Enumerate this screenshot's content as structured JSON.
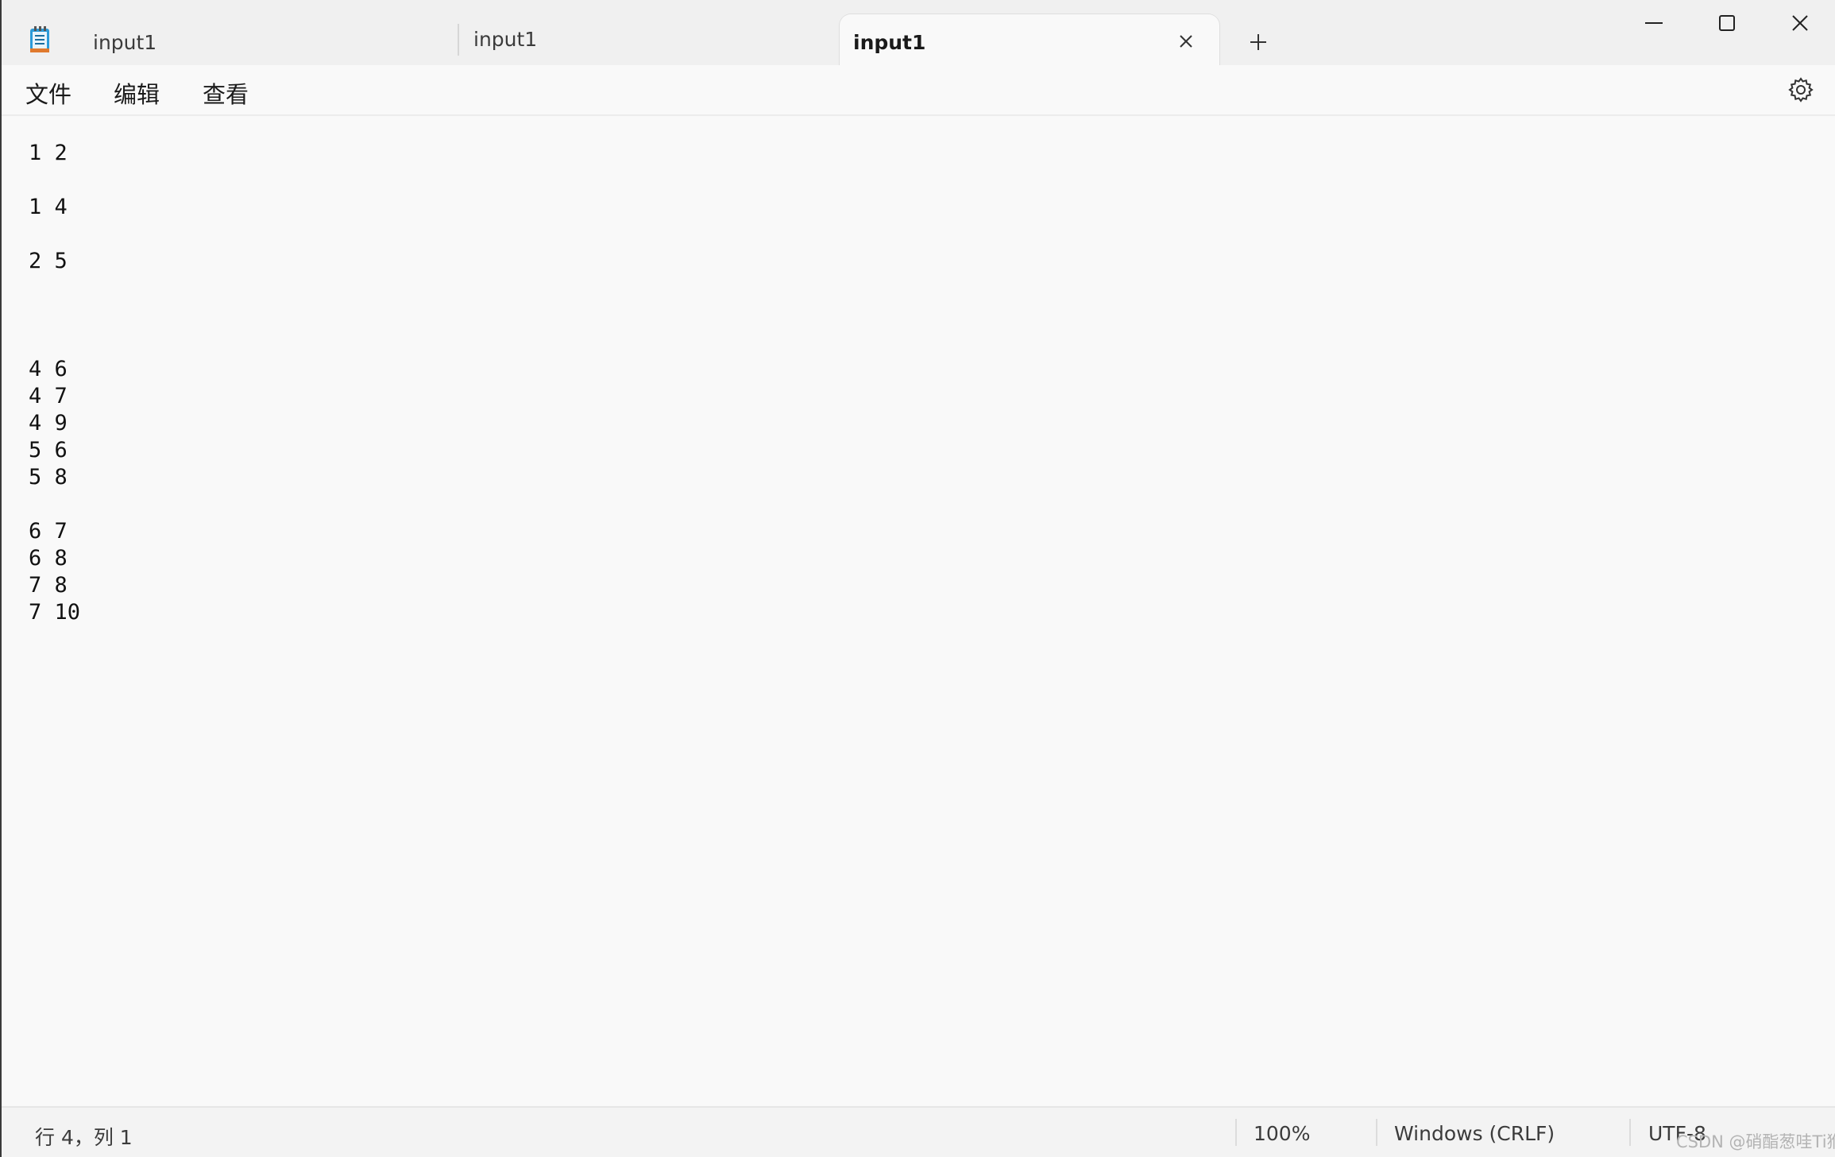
{
  "titlebar": {
    "app_icon": "notepad-icon",
    "tabs": [
      {
        "label": "input1",
        "active": false
      },
      {
        "label": "input1",
        "active": false
      },
      {
        "label": "input1",
        "active": true
      }
    ],
    "tab_close_icon": "close-icon",
    "new_tab_icon": "plus-icon",
    "window_controls": [
      "minimize-icon",
      "maximize-icon",
      "close-icon"
    ]
  },
  "menubar": {
    "items": [
      {
        "label": "文件"
      },
      {
        "label": "编辑"
      },
      {
        "label": "查看"
      }
    ],
    "settings_icon": "gear-icon"
  },
  "editor": {
    "content": "1 2\n\n1 4\n\n2 5\n\n\n\n4 6\n4 7\n4 9\n5 6\n5 8\n\n6 7\n6 8\n7 8\n7 10"
  },
  "statusbar": {
    "position": "行 4，列 1",
    "zoom": "100%",
    "line_ending": "Windows (CRLF)",
    "encoding": "UTF-8"
  },
  "watermark": "CSDN @硝酯葱哇Ti猴",
  "colors": {
    "titlebar_bg": "#f0f0f0",
    "editor_bg": "#f9f9f9",
    "text": "#111111",
    "status_text": "#3b3b3b"
  }
}
